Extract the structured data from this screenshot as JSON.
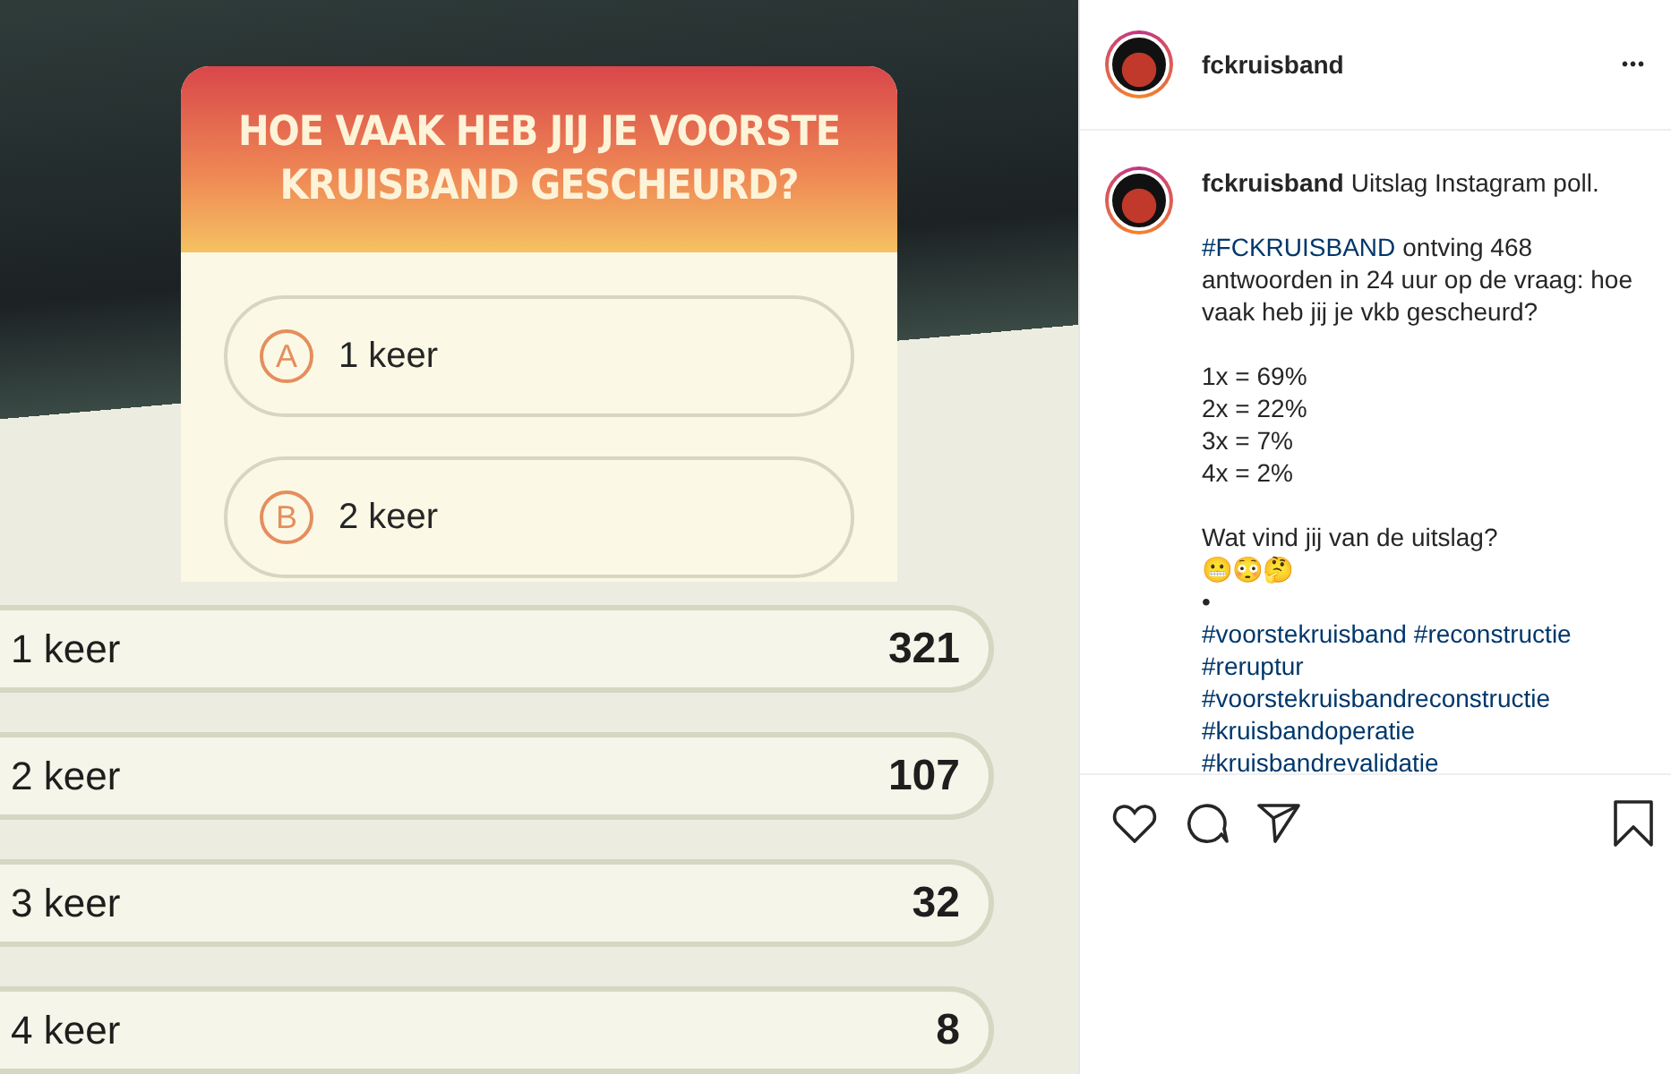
{
  "poll": {
    "question": "HOE VAAK HEB JIJ JE VOORSTE KRUISBAND GESCHEURD?",
    "options": [
      {
        "letter": "A",
        "label": "1 keer"
      },
      {
        "letter": "B",
        "label": "2 keer"
      }
    ],
    "results": [
      {
        "label": "1 keer",
        "count": "321"
      },
      {
        "label": "2 keer",
        "count": "107"
      },
      {
        "label": "3 keer",
        "count": "32"
      },
      {
        "label": "4 keer",
        "count": "8"
      }
    ]
  },
  "post": {
    "username": "fckruisband",
    "more": "•••",
    "caption": {
      "username": "fckruisband",
      "paragraphs": [
        {
          "lines": [
            {
              "parts": [
                {
                  "text": "Uitslag Instagram poll.",
                  "kind": "text"
                }
              ]
            }
          ]
        },
        {
          "lines": [
            {
              "parts": [
                {
                  "text": "#FCKRUISBAND",
                  "kind": "tag"
                },
                {
                  "text": "ontving 468",
                  "kind": "text"
                }
              ]
            },
            {
              "parts": [
                {
                  "text": "antwoorden in 24 uur op de vraag: hoe",
                  "kind": "text"
                }
              ]
            },
            {
              "parts": [
                {
                  "text": "vaak heb jij je vkb gescheurd?",
                  "kind": "text"
                }
              ]
            }
          ]
        },
        {
          "lines": [
            {
              "parts": [
                {
                  "text": "1x = 69%",
                  "kind": "text"
                }
              ]
            },
            {
              "parts": [
                {
                  "text": "2x = 22%",
                  "kind": "text"
                }
              ]
            },
            {
              "parts": [
                {
                  "text": "3x = 7%",
                  "kind": "text"
                }
              ]
            },
            {
              "parts": [
                {
                  "text": "4x = 2%",
                  "kind": "text"
                }
              ]
            }
          ]
        },
        {
          "lines": [
            {
              "parts": [
                {
                  "text": "Wat vind jij van de uitslag?",
                  "kind": "text"
                }
              ]
            },
            {
              "parts": [
                {
                  "text": "😬😳🤔",
                  "kind": "text"
                }
              ]
            },
            {
              "parts": [
                {
                  "text": "•",
                  "kind": "text"
                }
              ]
            },
            {
              "parts": [
                {
                  "text": "#voorstekruisband",
                  "kind": "tag"
                },
                {
                  "text": "#reconstructie",
                  "kind": "tag"
                }
              ]
            },
            {
              "parts": [
                {
                  "text": "#reruptur",
                  "kind": "tag"
                }
              ]
            },
            {
              "parts": [
                {
                  "text": "#voorstekruisbandreconstructie",
                  "kind": "tag"
                }
              ]
            },
            {
              "parts": [
                {
                  "text": "#kruisbandoperatie",
                  "kind": "tag"
                }
              ]
            },
            {
              "parts": [
                {
                  "text": "#kruisbandrevalidatie",
                  "kind": "tag"
                }
              ]
            }
          ]
        }
      ]
    }
  }
}
